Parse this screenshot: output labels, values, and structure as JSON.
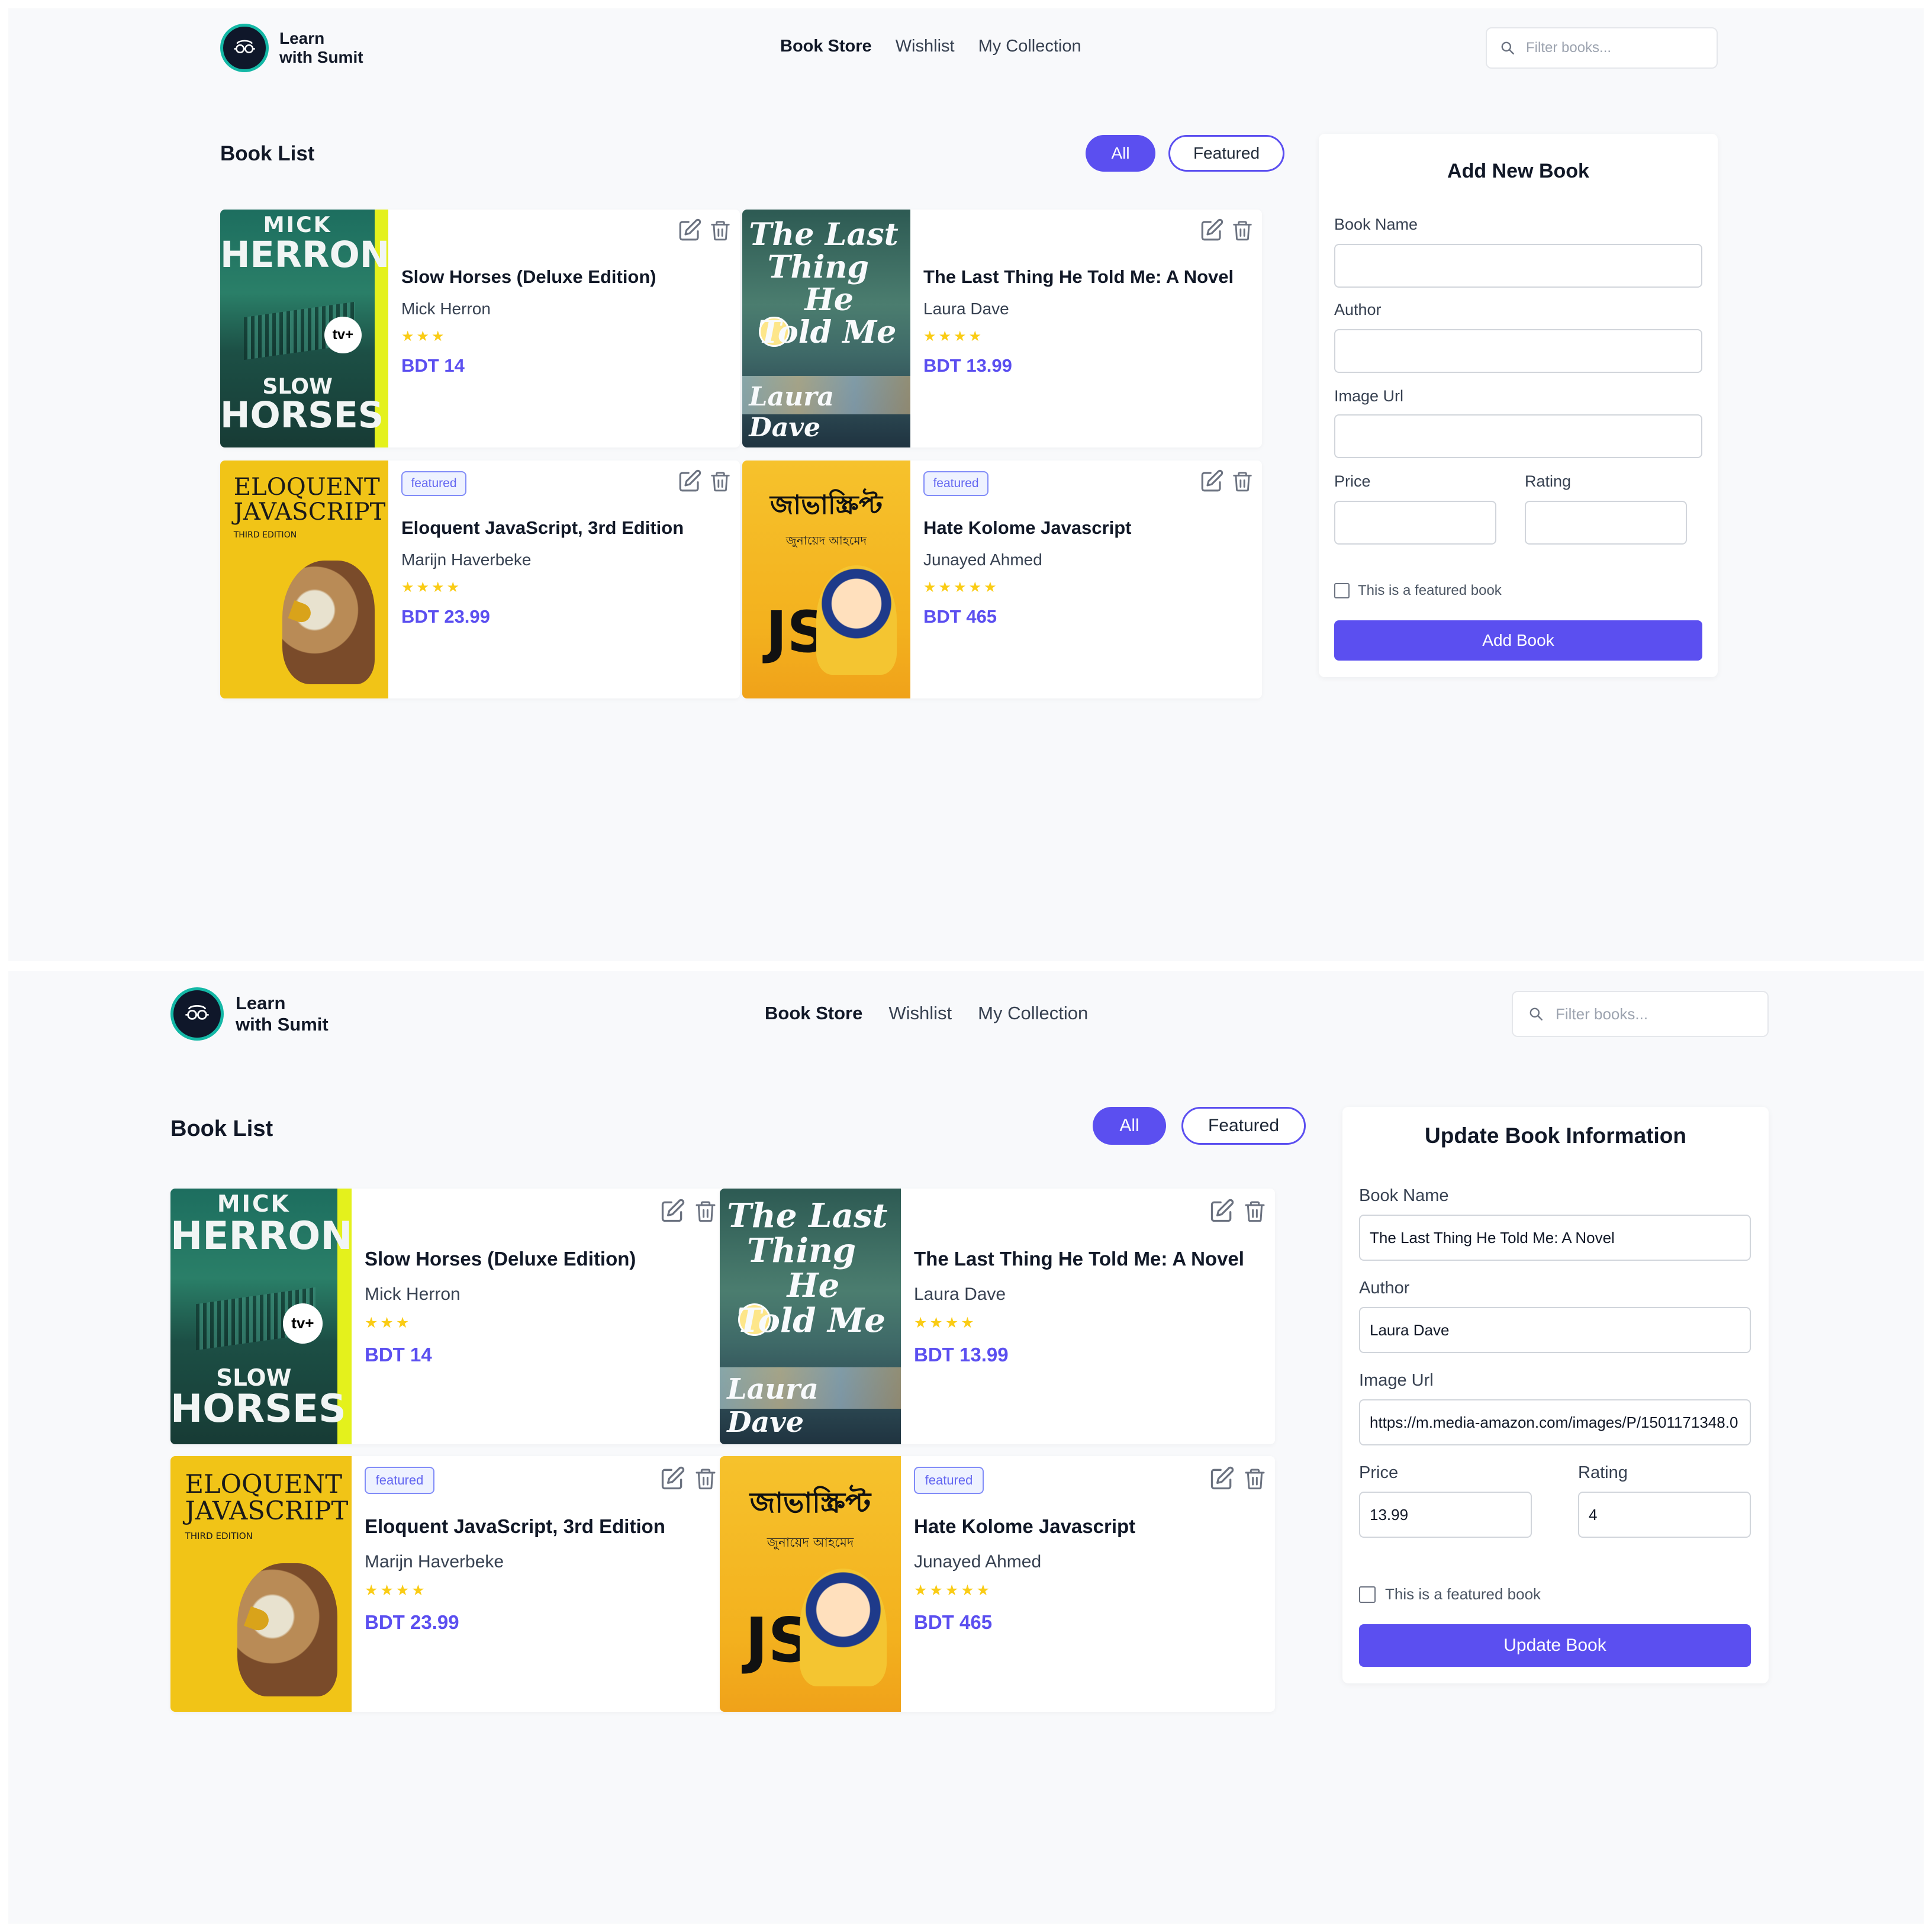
{
  "brand": {
    "line1": "Learn",
    "line2": "with Sumit"
  },
  "nav": {
    "items": [
      "Book Store",
      "Wishlist",
      "My Collection"
    ],
    "active": "Book Store"
  },
  "search": {
    "placeholder": "Filter books..."
  },
  "book_list": {
    "title": "Book List",
    "filters": [
      "All",
      "Featured"
    ],
    "active_filter": "All"
  },
  "books": [
    {
      "title": "Slow Horses (Deluxe Edition)",
      "author": "Mick Herron",
      "stars": "★★★",
      "rating": 3,
      "price": "BDT 14",
      "featured": false,
      "cover": {
        "top": "MICK",
        "main": "HERRON",
        "bottom1": "SLOW",
        "bottom2": "HORSES",
        "badge": "tv+"
      }
    },
    {
      "title": "The Last Thing He Told Me: A Novel",
      "author": "Laura Dave",
      "stars": "★★★★",
      "rating": 4,
      "price": "BDT 13.99",
      "featured": false,
      "cover": {
        "line1": "The Last",
        "line2": "Thing",
        "line3": "He",
        "line4": "Told Me",
        "author": "Laura Dave"
      }
    },
    {
      "title": "Eloquent JavaScript, 3rd Edition",
      "author": "Marijn Haverbeke",
      "stars": "★★★★",
      "rating": 4,
      "price": "BDT 23.99",
      "featured": true,
      "cover": {
        "line1": "ELOQUENT",
        "line2": "JAVASCRIPT",
        "edition": "THIRD EDITION"
      }
    },
    {
      "title": "Hate Kolome Javascript",
      "author": "Junayed Ahmed",
      "stars": "★★★★★",
      "rating": 5,
      "price": "BDT 465",
      "featured": true,
      "cover": {
        "line1": "জাভাস্ক্রিপ্ট",
        "author": "জুনায়েদ আহমেদ",
        "js": "JS"
      }
    }
  ],
  "badge_label": "featured",
  "add_form": {
    "title": "Add New Book",
    "labels": {
      "name": "Book Name",
      "author": "Author",
      "image": "Image Url",
      "price": "Price",
      "rating": "Rating"
    },
    "values": {
      "name": "",
      "author": "",
      "image": "",
      "price": "",
      "rating": ""
    },
    "featured_label": "This is a featured book",
    "featured_checked": false,
    "submit": "Add Book"
  },
  "update_form": {
    "title": "Update Book Information",
    "labels": {
      "name": "Book Name",
      "author": "Author",
      "image": "Image Url",
      "price": "Price",
      "rating": "Rating"
    },
    "values": {
      "name": "The Last Thing He Told Me: A Novel",
      "author": "Laura Dave",
      "image": "https://m.media-amazon.com/images/P/1501171348.0",
      "price": "13.99",
      "rating": "4"
    },
    "featured_label": "This is a featured book",
    "featured_checked": false,
    "submit": "Update Book"
  },
  "colors": {
    "accent": "#5b4ff0",
    "star": "#facc15",
    "panel_bg": "#f8f9fb",
    "teal": "#14b8a6"
  }
}
